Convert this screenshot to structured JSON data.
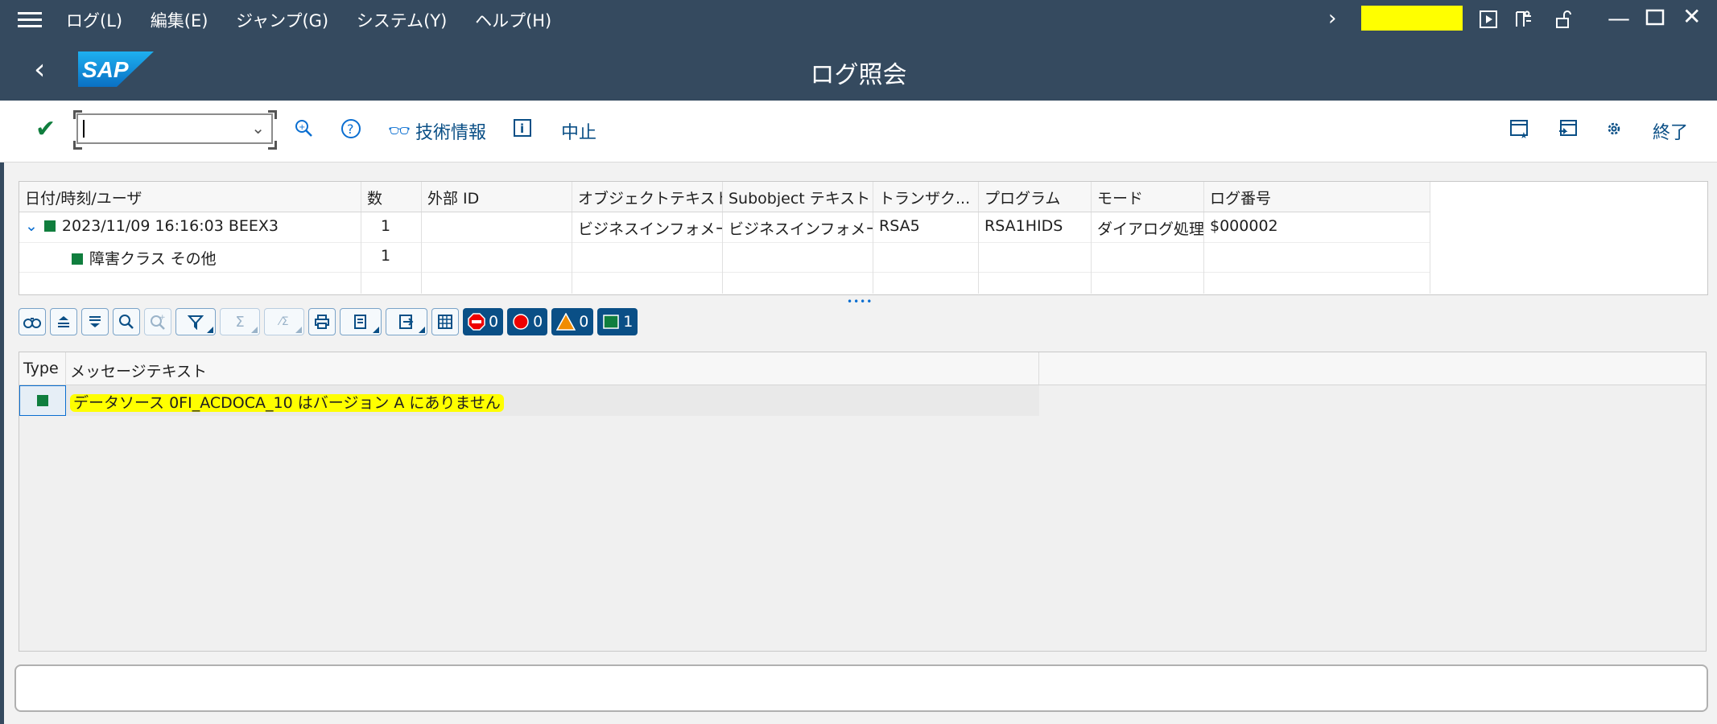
{
  "menubar": {
    "items": [
      "ログ(L)",
      "編集(E)",
      "ジャンプ(G)",
      "システム(Y)",
      "ヘルプ(H)"
    ],
    "highlight_color": "#ffff00"
  },
  "titlebar": {
    "logo_text": "SAP",
    "title": "ログ照会"
  },
  "toolbar": {
    "command_value": "",
    "tech_info_label": "技術情報",
    "cancel_label": "中止",
    "exit_label": "終了"
  },
  "log_table": {
    "columns": [
      "日付/時刻/ユーザ",
      "数",
      "外部 ID",
      "オブジェクトテキスト",
      "Subobject テキスト",
      "トランザク...",
      "プログラム",
      "モード",
      "ログ番号"
    ],
    "rows": [
      {
        "datetime_user": "2023/11/09  16:16:03  BEEX3",
        "count": "1",
        "external_id": "",
        "object_text": "ビジネスインフォメーシ",
        "subobject_text": "ビジネスインフォメーシ",
        "transaction": "RSA5",
        "program": "RSA1HIDS",
        "mode": "ダイアログ処理",
        "log_number": "$000002"
      },
      {
        "datetime_user": "障害クラス その他",
        "count": "1",
        "external_id": "",
        "object_text": "",
        "subobject_text": "",
        "transaction": "",
        "program": "",
        "mode": "",
        "log_number": ""
      }
    ]
  },
  "message_toolbar": {
    "stop_count": "0",
    "error_count": "0",
    "warning_count": "0",
    "info_count": "1"
  },
  "message_table": {
    "columns": [
      "Type",
      "メッセージテキスト"
    ],
    "rows": [
      {
        "type": "success",
        "text": "データソース 0FI_ACDOCA_10 はバージョン A にありません"
      }
    ]
  },
  "status_bar": {
    "text": ""
  }
}
